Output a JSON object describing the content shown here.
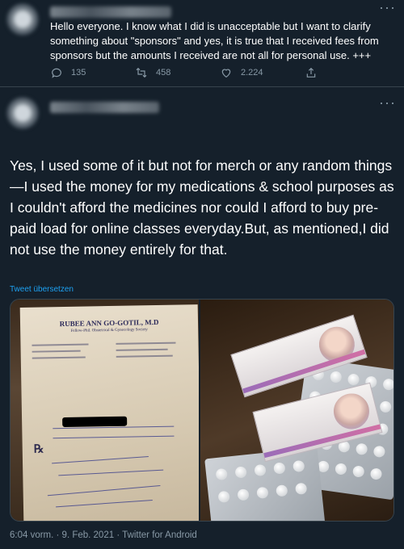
{
  "tweet1": {
    "text": "Hello everyone. I know what I did is unacceptable but I want to clarify something about \"sponsors\" and yes, it is true that I received fees from sponsors but the amounts I received are not all for personal use.  +++",
    "replies": "135",
    "retweets": "458",
    "likes": "2.224"
  },
  "tweet2": {
    "text": "Yes, I used some of it but not for merch or any random things—I used the money for my medications & school purposes as I couldn't afford the medicines nor could I afford to buy pre-paid load for online classes everyday.But, as mentioned,I did not use the money entirely for that.",
    "translate": "Tweet übersetzen",
    "footer": "6:04 vorm. · 9. Feb. 2021 · Twitter for Android"
  },
  "prescription": {
    "doctor": "RUBEE ANN GO-GOTIL, M.D",
    "subtitle": "Fellow-Phil. Obstetrical & Gynecology Society"
  },
  "icons": {
    "more": "more-icon",
    "reply": "reply-icon",
    "retweet": "retweet-icon",
    "like": "heart-icon",
    "share": "share-icon"
  },
  "colors": {
    "background": "#15202b",
    "muted": "#8899a6",
    "link": "#1da1f2",
    "border": "#38444d"
  }
}
